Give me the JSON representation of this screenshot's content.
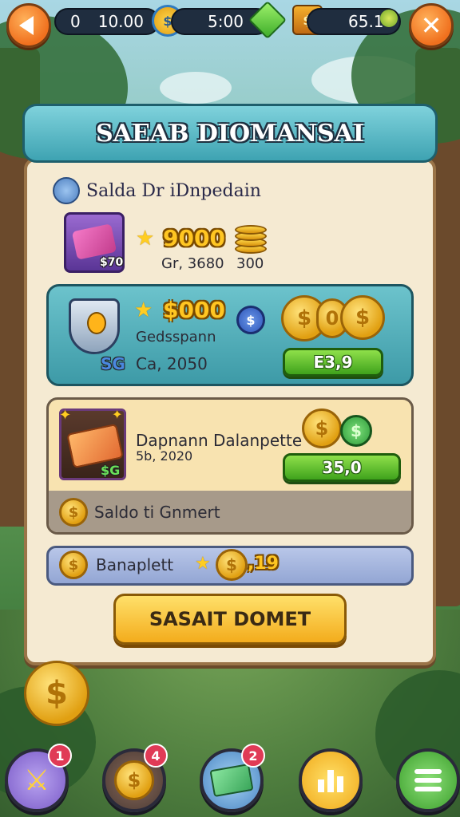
{
  "topbar": {
    "pill1_a": "0",
    "pill1_b": "10.00",
    "pill2": "5:00",
    "pill3": "65.1"
  },
  "panel": {
    "title": "SAEAB DIOMANSAI",
    "saldo_title": "Salda Dr iDnpedain"
  },
  "row1": {
    "badge": "$70",
    "amount": "9000",
    "sub": "Gr, 3680",
    "coins_value": "300"
  },
  "row2": {
    "badge": "SG",
    "amount": "$000",
    "name": "Gedsspann",
    "sub": "Ca, 2050",
    "button_label": "E3,9"
  },
  "row3": {
    "badge": "$G",
    "name": "Dapnann Dalanpette",
    "date": "5b, 2020",
    "button_label": "35,0",
    "footer_label": "Saldo ti Gnmert"
  },
  "row4": {
    "label": "Banaplett",
    "value": ",19"
  },
  "main_button": {
    "label": "SASAIT DOMET"
  },
  "bottom_nav": {
    "badge1": "1",
    "badge2": "4",
    "badge3": "2"
  },
  "colors": {
    "accent_teal": "#3ea3b2",
    "gold": "#ffc622",
    "green_button": "#3fa21c",
    "orange_button": "#f0701e",
    "notif_red": "#e03a56"
  }
}
